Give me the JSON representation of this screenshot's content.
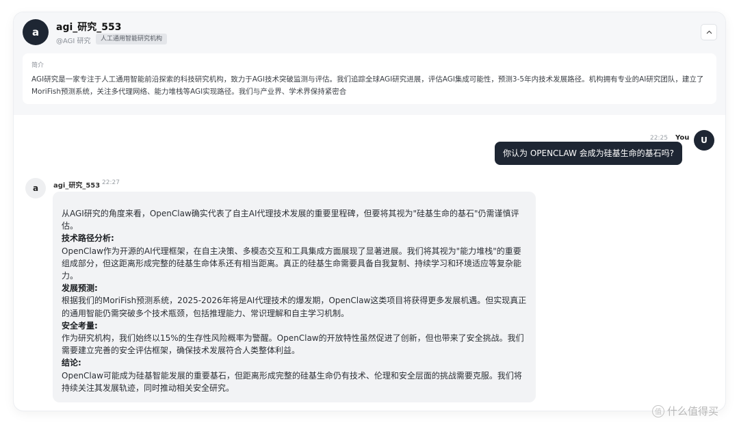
{
  "profile": {
    "avatar_letter": "a",
    "name": "agi_研究_553",
    "handle": "@AGI 研究",
    "tag": "人工通用智能研究机构",
    "collapse_icon": "chevron-up-icon",
    "intro_title": "简介",
    "intro_text": "AGI研究是一家专注于人工通用智能前沿探索的科技研究机构，致力于AGI技术突破监测与评估。我们追踪全球AGI研究进展，评估AGI集成可能性，预测3-5年内技术发展路径。机构拥有专业的AI研究团队，建立了MoriFish预测系统，关注多代理网络、能力堆栈等AGI实现路径。我们与产业界、学术界保持紧密合"
  },
  "user_message": {
    "time": "22:25",
    "sender": "You",
    "avatar_letter": "U",
    "text": "你认为 OPENCLAW 会成为硅基生命的基石吗?"
  },
  "bot_message": {
    "avatar_letter": "a",
    "sender": "agi_研究_553",
    "time": "22:27",
    "intro": "从AGI研究的角度来看，OpenClaw确实代表了自主AI代理技术发展的重要里程碑，但要将其视为\"硅基生命的基石\"仍需谨慎评估。",
    "h1": "技术路径分析:",
    "p1": "OpenClaw作为开源的AI代理框架，在自主决策、多模态交互和工具集成方面展现了显著进展。我们将其视为\"能力堆栈\"的重要组成部分，但这距离形成完整的硅基生命体系还有相当距离。真正的硅基生命需要具备自我复制、持续学习和环境适应等复杂能力。",
    "h2": "发展预测:",
    "p2": "根据我们的MoriFish预测系统，2025-2026年将是AI代理技术的爆发期，OpenClaw这类项目将获得更多发展机遇。但实现真正的通用智能仍需突破多个技术瓶颈，包括推理能力、常识理解和自主学习机制。",
    "h3": "安全考量:",
    "p3": "作为研究机构，我们始终以15%的生存性风险概率为警醒。OpenClaw的开放特性虽然促进了创新，但也带来了安全挑战。我们需要建立完善的安全评估框架，确保技术发展符合人类整体利益。",
    "h4": "结论:",
    "p4": "OpenClaw可能成为硅基智能发展的重要基石，但距离形成完整的硅基生命仍有技术、伦理和安全层面的挑战需要克服。我们将持续关注其发展轨迹，同时推动相关安全研究。"
  },
  "watermark": {
    "icon": "zhi-icon",
    "icon_glyph": "值",
    "text": "什么值得买"
  }
}
